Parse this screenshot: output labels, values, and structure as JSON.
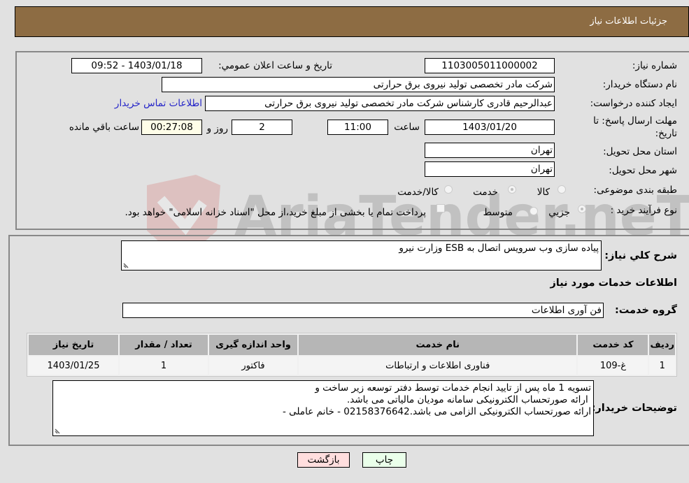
{
  "header": {
    "title": "جزئیات اطلاعات نیاز"
  },
  "details": {
    "need_number_label": "شماره نیاز:",
    "need_number": "1103005011000002",
    "announce_label": "تاریخ و ساعت اعلان عمومي:",
    "announce_value": "1403/01/18 - 09:52",
    "buyer_org_label": "نام دستگاه خریدار:",
    "buyer_org": "شرکت مادر تخصصی تولید نیروی برق حرارتی",
    "creator_label": "ایجاد کننده درخواست:",
    "creator": "عبدالرحیم قادری کارشناس شرکت مادر تخصصی تولید نیروی برق حرارتی",
    "contact_link": "اطلاعات تماس خریدار",
    "deadline_label_line1": "مهلت ارسال پاسخ: تا",
    "deadline_label_line2": "تاریخ:",
    "deadline_date": "1403/01/20",
    "time_label": "ساعت",
    "deadline_time": "11:00",
    "days_value": "2",
    "days_label": "روز و",
    "remaining_value": "00:27:08",
    "remaining_label": "ساعت باقي مانده",
    "province_label": "استان محل تحویل:",
    "province": "تهران",
    "city_label": "شهر محل تحویل:",
    "city": "تهران",
    "category_label": "طبقه بندی موضوعی:",
    "category_options": [
      {
        "label": "کالا",
        "checked": false
      },
      {
        "label": "خدمت",
        "checked": true
      },
      {
        "label": "کالا/خدمت",
        "checked": false
      }
    ],
    "process_label": "نوع فرآیند خرید :",
    "process_options": [
      {
        "label": "جزيي",
        "checked": true
      },
      {
        "label": "متوسط",
        "checked": false
      }
    ],
    "treasury_note": "پرداخت تمام یا بخشی از مبلغ خرید،از محل \"اسناد خزانه اسلامی\" خواهد بود."
  },
  "services": {
    "description_label": "شرح کلي نیاز:",
    "description": "پیاده سازی وب سرویس اتصال به ESB وزارت نیرو",
    "section_title": "اطلاعات خدمات مورد نیاز",
    "group_label": "گروه خدمت:",
    "group_value": "فن آوری اطلاعات",
    "table": {
      "headers": [
        "ردیف",
        "کد خدمت",
        "نام خدمت",
        "واحد اندازه گیری",
        "تعداد / مقدار",
        "تاریخ نیاز"
      ],
      "rows": [
        [
          "1",
          "غ-109",
          "فناوری اطلاعات و ارتباطات",
          "فاکتور",
          "1",
          "1403/01/25"
        ]
      ]
    },
    "buyer_notes_label": "توضیحات خریدار:",
    "buyer_notes": [
      "تسویه 1 ماه پس از تایید انجام خدمات توسط دفتر توسعه زیر ساخت و",
      " ارائه صورتحساب الکترونیکی سامانه مودیان مالیاتی می باشد.",
      "ارائه صورتحساب الکترونیکی الزامی می باشد.02158376642 - خانم عاملی -"
    ]
  },
  "buttons": {
    "print": "چاپ",
    "back": "بازگشت"
  },
  "watermark": {
    "text": "AriaTender.neT"
  },
  "colors": {
    "header_bg": "#8d6c43",
    "link": "#2424c8",
    "print_bg": "#eaffea",
    "back_bg": "#ffdede",
    "remaining_bg": "#fefde8"
  }
}
